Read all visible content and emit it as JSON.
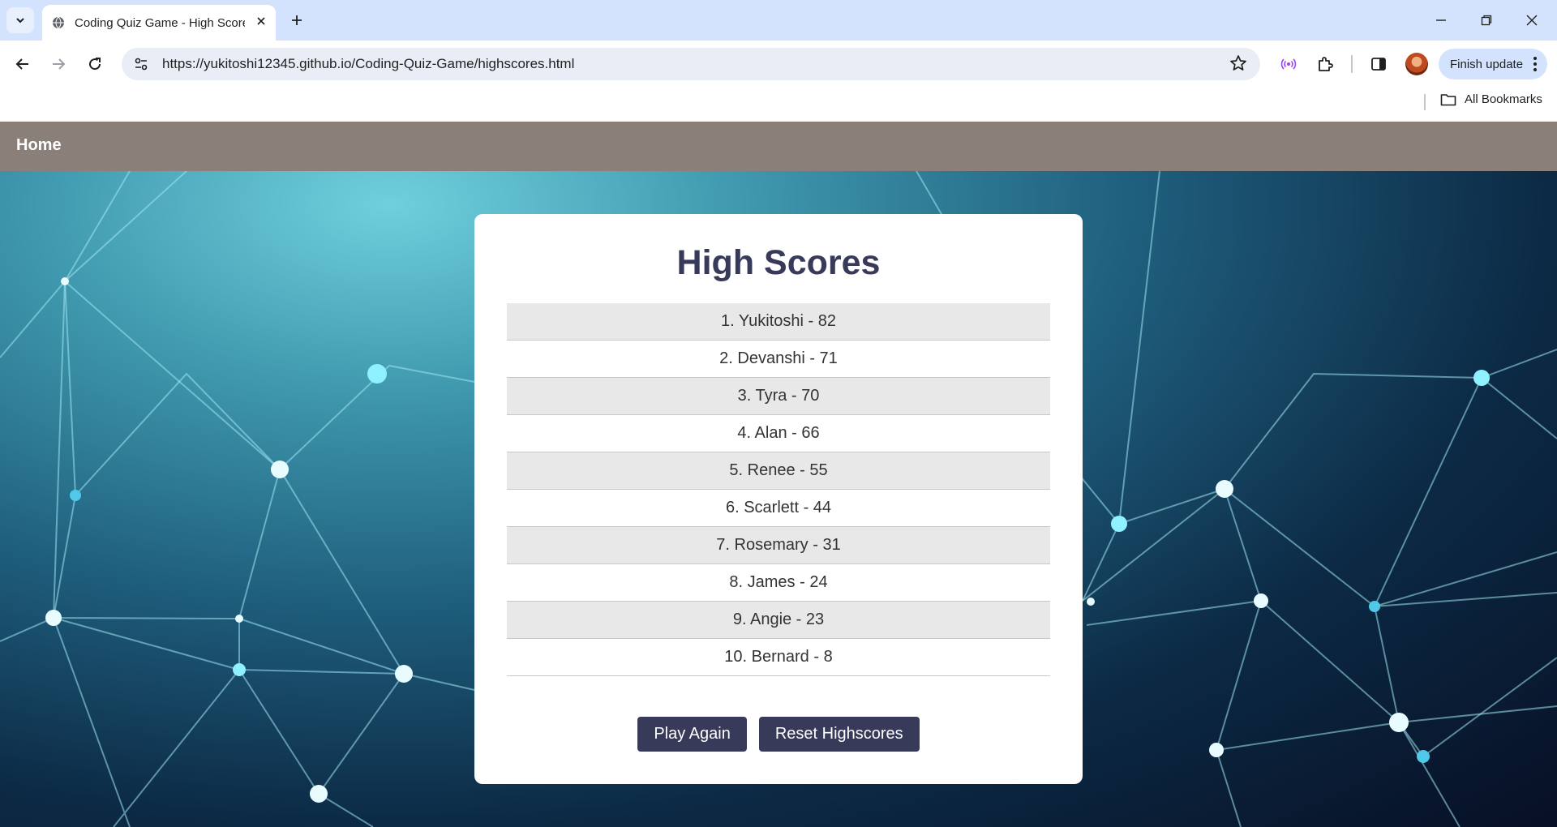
{
  "browser": {
    "tab_title": "Coding Quiz Game - High Scores",
    "url": "https://yukitoshi12345.github.io/Coding-Quiz-Game/highscores.html",
    "finish_update_label": "Finish update",
    "all_bookmarks_label": "All Bookmarks",
    "tabstrip_color": "#d3e3fd"
  },
  "nav": {
    "home_label": "Home",
    "bar_color": "#8b7f7a"
  },
  "highscores": {
    "title": "High Scores",
    "entries": [
      "1. Yukitoshi - 82",
      "2. Devanshi - 71",
      "3. Tyra - 70",
      "4. Alan - 66",
      "5. Renee - 55",
      "6. Scarlett - 44",
      "7. Rosemary - 31",
      "8. James - 24",
      "9. Angie - 23",
      "10. Bernard - 8"
    ],
    "play_again_label": "Play Again",
    "reset_label": "Reset Highscores",
    "accent_color": "#383a5a"
  }
}
